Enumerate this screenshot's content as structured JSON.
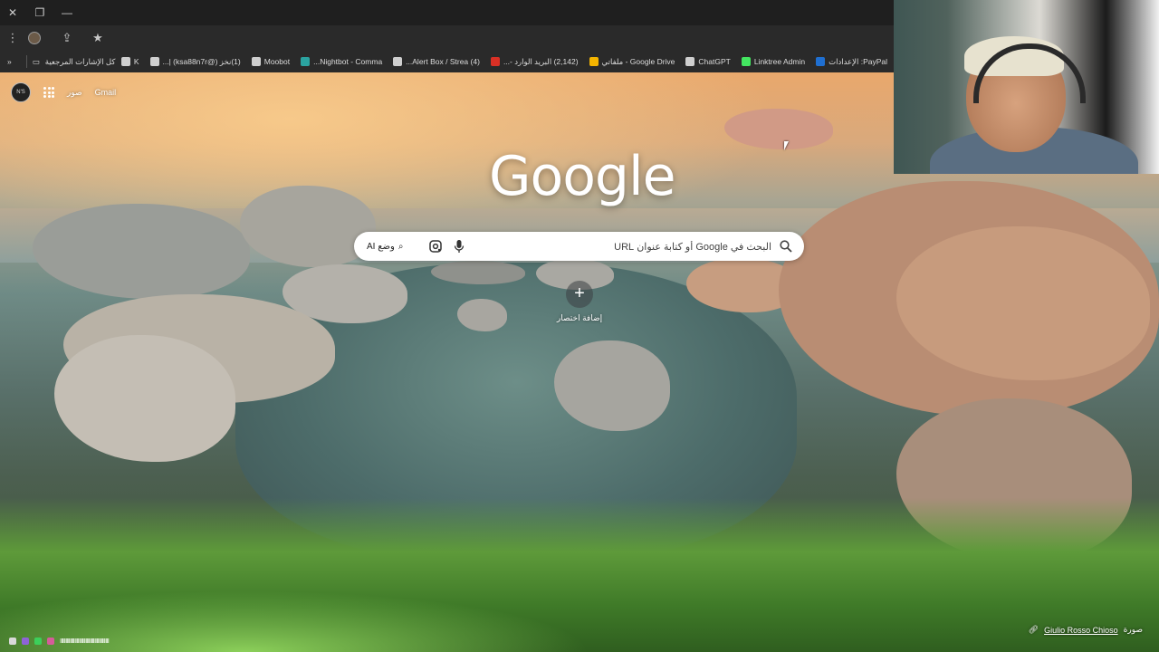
{
  "window": {
    "close_icon": "close-icon",
    "restore_icon": "restore-icon",
    "minimize_icon": "minimize-icon"
  },
  "toolbar": {
    "menu_icon": "kebab-menu-icon",
    "extension_icon": "extension-icon",
    "share_icon": "share-icon",
    "bookmark_icon": "star-icon"
  },
  "bookmarks": {
    "all_bookmarks": "كل الإشارات المرجعية",
    "items": [
      {
        "label": "PayPal: الإعدادات",
        "color": "#1f6fd1"
      },
      {
        "label": "Linktree Admin",
        "color": "#43e660"
      },
      {
        "label": "ChatGPT",
        "color": "#cfcfcf"
      },
      {
        "label": "Google Drive - ملفاتي",
        "color": "#f4b400"
      },
      {
        "label": "(2,142) البريد الوارد -...",
        "color": "#d93025"
      },
      {
        "label": "(4) Alert Box / Strea...",
        "color": "#cfcfcf"
      },
      {
        "label": "Nightbot - Comma...",
        "color": "#2ba3a0"
      },
      {
        "label": "Moobot",
        "color": "#cfcfcf"
      },
      {
        "label": "(1)نخز (@ksa88n7r) |...",
        "color": "#cfcfcf"
      },
      {
        "label": "K",
        "color": "#cfcfcf"
      }
    ]
  },
  "ntp": {
    "gmail": "Gmail",
    "images": "صور",
    "avatar_text": "N'S",
    "logo": "Google",
    "search_placeholder": "البحث في Google أو كتابة عنوان URL",
    "ai_mode": "وضع AI",
    "shortcut_label": "إضافة اختصار",
    "shortcut_symbol": "+"
  },
  "credit": {
    "prefix": "صورة",
    "name": "Giulio Rosso Chioso"
  },
  "taskbar": {
    "text": "ⅡⅡⅡⅡⅡⅡⅡⅡⅡⅡⅡⅡⅡⅡⅡⅡⅡⅡⅡⅡⅡⅡ"
  }
}
